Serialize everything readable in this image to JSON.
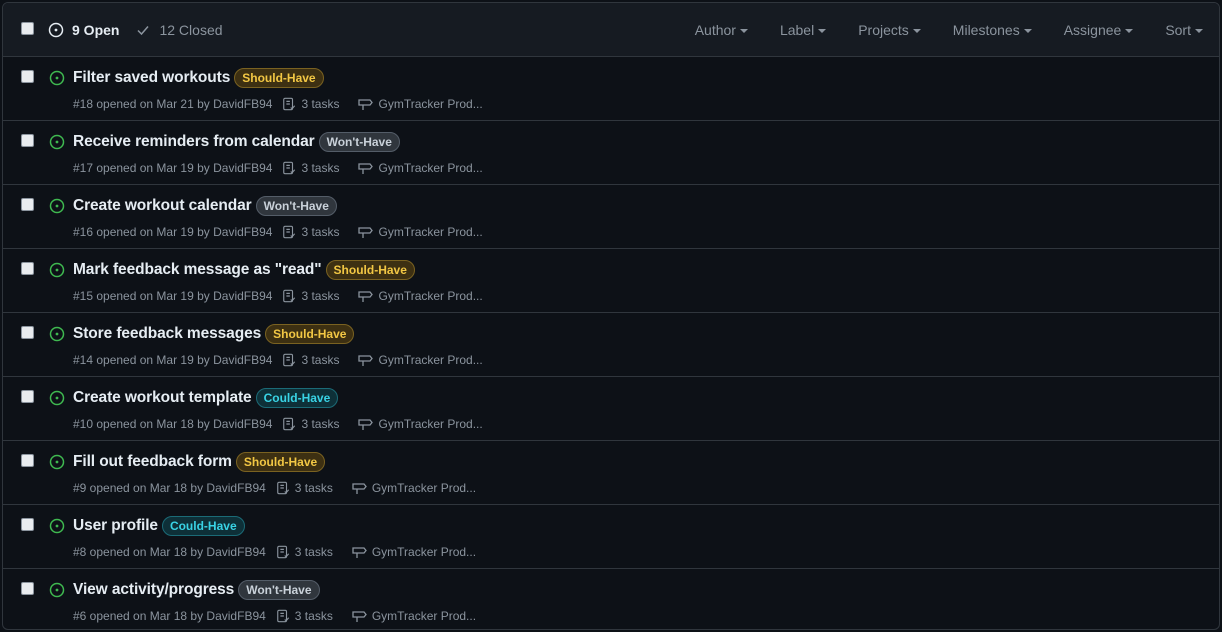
{
  "header": {
    "open_label": "9 Open",
    "closed_label": "12 Closed",
    "filters": [
      "Author",
      "Label",
      "Projects",
      "Milestones",
      "Assignee",
      "Sort"
    ]
  },
  "colors": {
    "open_green": "#3fb950",
    "should_have": "#f2c744",
    "wont_have": "#c9d1d9",
    "could_have": "#39d3e5"
  },
  "issues": [
    {
      "title": "Filter saved workouts",
      "label": "Should-Have",
      "label_kind": "should",
      "meta": "#18 opened on Mar 21 by DavidFB94",
      "tasks": "3 tasks",
      "project": "GymTracker Prod..."
    },
    {
      "title": "Receive reminders from calendar",
      "label": "Won't-Have",
      "label_kind": "wont",
      "meta": "#17 opened on Mar 19 by DavidFB94",
      "tasks": "3 tasks",
      "project": "GymTracker Prod..."
    },
    {
      "title": "Create workout calendar",
      "label": "Won't-Have",
      "label_kind": "wont",
      "meta": "#16 opened on Mar 19 by DavidFB94",
      "tasks": "3 tasks",
      "project": "GymTracker Prod..."
    },
    {
      "title": "Mark feedback message as \"read\"",
      "label": "Should-Have",
      "label_kind": "should",
      "meta": "#15 opened on Mar 19 by DavidFB94",
      "tasks": "3 tasks",
      "project": "GymTracker Prod..."
    },
    {
      "title": "Store feedback messages",
      "label": "Should-Have",
      "label_kind": "should",
      "meta": "#14 opened on Mar 19 by DavidFB94",
      "tasks": "3 tasks",
      "project": "GymTracker Prod..."
    },
    {
      "title": "Create workout template",
      "label": "Could-Have",
      "label_kind": "could",
      "meta": "#10 opened on Mar 18 by DavidFB94",
      "tasks": "3 tasks",
      "project": "GymTracker Prod..."
    },
    {
      "title": "Fill out feedback form",
      "label": "Should-Have",
      "label_kind": "should",
      "meta": "#9 opened on Mar 18 by DavidFB94",
      "tasks": "3 tasks",
      "project": "GymTracker Prod..."
    },
    {
      "title": "User profile",
      "label": "Could-Have",
      "label_kind": "could",
      "meta": "#8 opened on Mar 18 by DavidFB94",
      "tasks": "3 tasks",
      "project": "GymTracker Prod..."
    },
    {
      "title": "View activity/progress",
      "label": "Won't-Have",
      "label_kind": "wont",
      "meta": "#6 opened on Mar 18 by DavidFB94",
      "tasks": "3 tasks",
      "project": "GymTracker Prod..."
    }
  ]
}
